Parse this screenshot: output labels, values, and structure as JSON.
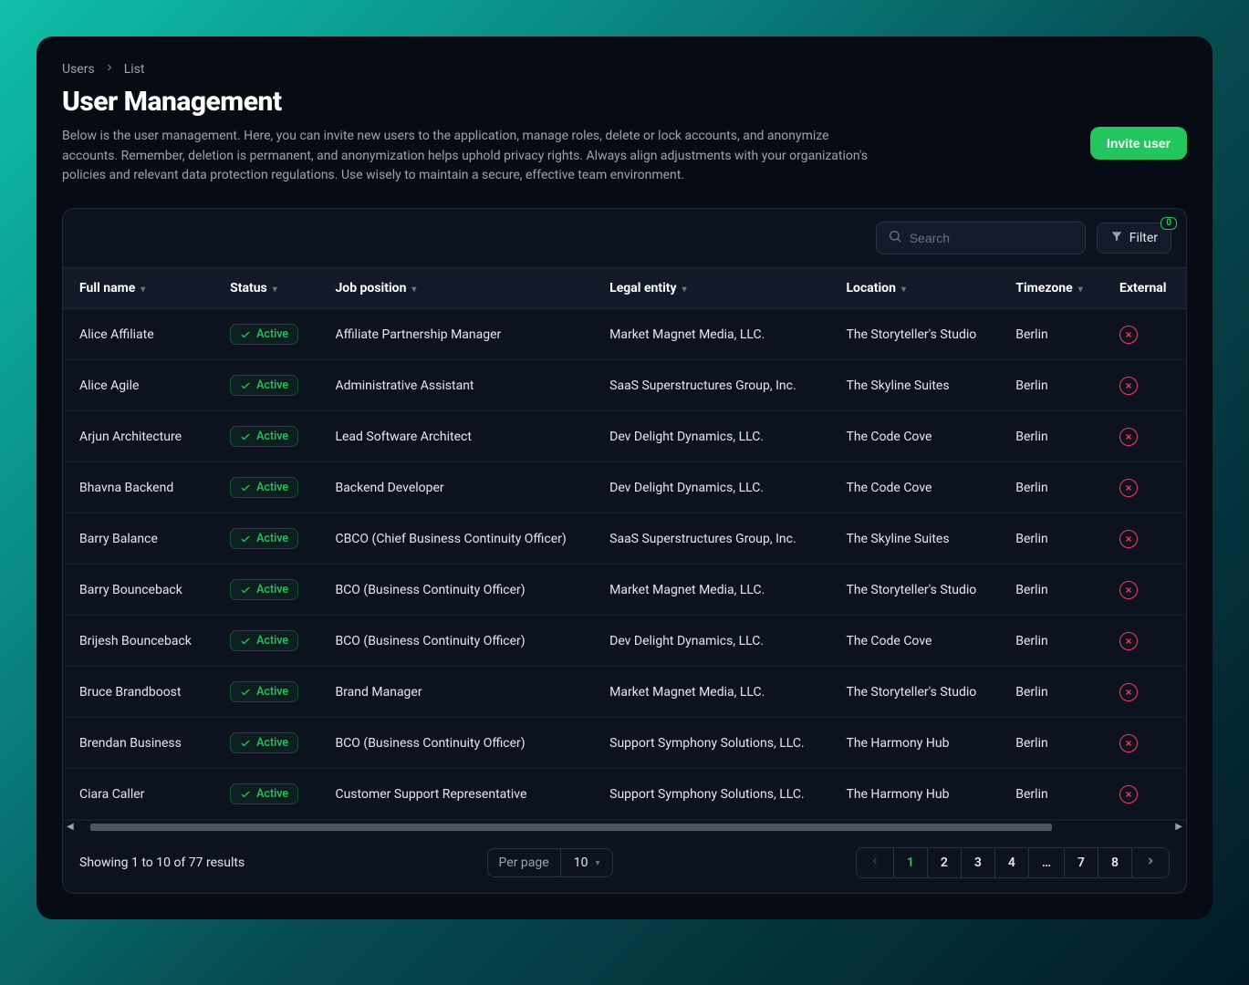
{
  "breadcrumb": {
    "root": "Users",
    "current": "List"
  },
  "page_title": "User Management",
  "description": "Below is the user management. Here, you can invite new users to the application, manage roles, delete or lock accounts, and anonymize accounts. Remember, deletion is permanent, and anonymization helps uphold privacy rights. Always align adjustments with your organization's policies and relevant data protection regulations. Use wisely to maintain a secure, effective team environment.",
  "invite_label": "Invite user",
  "search_placeholder": "Search",
  "filter": {
    "label": "Filter",
    "badge": "0"
  },
  "columns": {
    "full_name": "Full name",
    "status": "Status",
    "job": "Job position",
    "entity": "Legal entity",
    "location": "Location",
    "timezone": "Timezone",
    "external": "External"
  },
  "status_label": "Active",
  "rows": [
    {
      "name": "Alice Affiliate",
      "job": "Affiliate Partnership Manager",
      "entity": "Market Magnet Media, LLC.",
      "location": "The Storyteller's Studio",
      "tz": "Berlin"
    },
    {
      "name": "Alice Agile",
      "job": "Administrative Assistant",
      "entity": "SaaS Superstructures Group, Inc.",
      "location": "The Skyline Suites",
      "tz": "Berlin"
    },
    {
      "name": "Arjun Architecture",
      "job": "Lead Software Architect",
      "entity": "Dev Delight Dynamics, LLC.",
      "location": "The Code Cove",
      "tz": "Berlin"
    },
    {
      "name": "Bhavna Backend",
      "job": "Backend Developer",
      "entity": "Dev Delight Dynamics, LLC.",
      "location": "The Code Cove",
      "tz": "Berlin"
    },
    {
      "name": "Barry Balance",
      "job": "CBCO (Chief Business Continuity Officer)",
      "entity": "SaaS Superstructures Group, Inc.",
      "location": "The Skyline Suites",
      "tz": "Berlin"
    },
    {
      "name": "Barry Bounceback",
      "job": "BCO (Business Continuity Officer)",
      "entity": "Market Magnet Media, LLC.",
      "location": "The Storyteller's Studio",
      "tz": "Berlin"
    },
    {
      "name": "Brijesh Bounceback",
      "job": "BCO (Business Continuity Officer)",
      "entity": "Dev Delight Dynamics, LLC.",
      "location": "The Code Cove",
      "tz": "Berlin"
    },
    {
      "name": "Bruce Brandboost",
      "job": "Brand Manager",
      "entity": "Market Magnet Media, LLC.",
      "location": "The Storyteller's Studio",
      "tz": "Berlin"
    },
    {
      "name": "Brendan Business",
      "job": "BCO (Business Continuity Officer)",
      "entity": "Support Symphony Solutions, LLC.",
      "location": "The Harmony Hub",
      "tz": "Berlin"
    },
    {
      "name": "Ciara Caller",
      "job": "Customer Support Representative",
      "entity": "Support Symphony Solutions, LLC.",
      "location": "The Harmony Hub",
      "tz": "Berlin"
    }
  ],
  "footer": {
    "summary": "Showing 1 to 10 of 77 results",
    "per_page_label": "Per page",
    "per_page_value": "10",
    "pages": [
      "1",
      "2",
      "3",
      "4",
      "…",
      "7",
      "8"
    ],
    "active_page": "1"
  }
}
